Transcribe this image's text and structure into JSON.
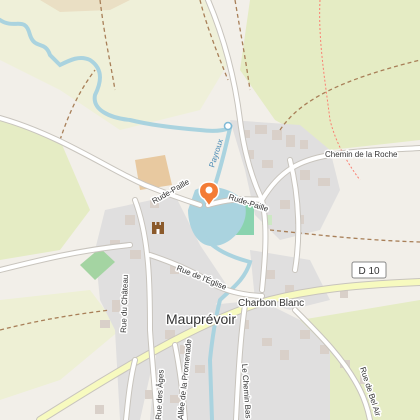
{
  "map": {
    "colors": {
      "background": "#f2efe9",
      "farmland": "#eef0d5",
      "meadow": "#e5ecc4",
      "built_area": "#e0dfdf",
      "building": "#d9d0c9",
      "pitch": "#8ad3af",
      "water": "#aad3df",
      "road_white": "#ffffff",
      "road_yellow": "#f7fabf",
      "road_casing": "#c8c4bd",
      "track": "#a87f58",
      "path_red": "#fa8072",
      "marker": "#f37c36"
    },
    "labels": {
      "town": "Mauprévoir",
      "hamlet": "Charbon Blanc",
      "road_badge": "D 10",
      "streets": {
        "chemin_roche": "Chemin de la Roche",
        "rude_paille_east": "Rude-Paille",
        "rude_paille_west": "Rude-Paille",
        "rue_eglise": "Rue de l'Église",
        "rue_chateau": "Rue du Château",
        "allee_promenade": "Allée de la Promenade",
        "chemin_bas": "Le Chemin Bas",
        "rue_bel_air": "Rue de Bel Air",
        "rue_ages": "Rue des Âges",
        "river": "Payroux"
      }
    },
    "icons": {
      "marker": "map-pin-icon",
      "castle": "castle-icon",
      "water_point": "water-point-icon"
    }
  }
}
